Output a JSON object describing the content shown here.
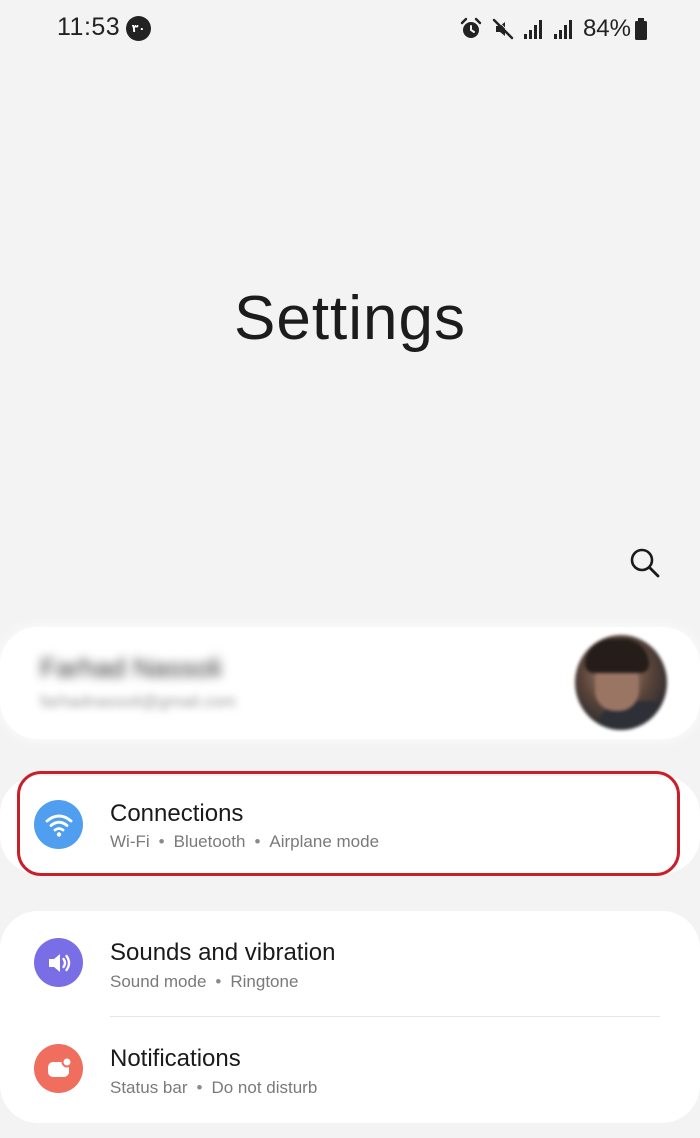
{
  "status_bar": {
    "time": "11:53",
    "notification_badge": "۳۰",
    "battery": "84%",
    "icons": [
      "alarm-icon",
      "mute-icon",
      "signal-icon",
      "signal-icon",
      "battery-icon"
    ]
  },
  "header": {
    "title": "Settings"
  },
  "search": {
    "icon": "search-icon"
  },
  "profile": {
    "name": "Farhad Nassoli",
    "email": "farhadnassoli@gmail.com"
  },
  "settings_items": [
    {
      "title": "Connections",
      "subtitle_parts": [
        "Wi-Fi",
        "Bluetooth",
        "Airplane mode"
      ],
      "icon": "wifi-icon",
      "icon_color": "#4f9ef0",
      "highlighted": true
    },
    {
      "title": "Sounds and vibration",
      "subtitle_parts": [
        "Sound mode",
        "Ringtone"
      ],
      "icon": "speaker-icon",
      "icon_color": "#7a6ee6"
    },
    {
      "title": "Notifications",
      "subtitle_parts": [
        "Status bar",
        "Do not disturb"
      ],
      "icon": "notification-icon",
      "icon_color": "#ef6e5e"
    }
  ],
  "colors": {
    "highlight": "#c7202b",
    "background": "#f3f3f3"
  }
}
